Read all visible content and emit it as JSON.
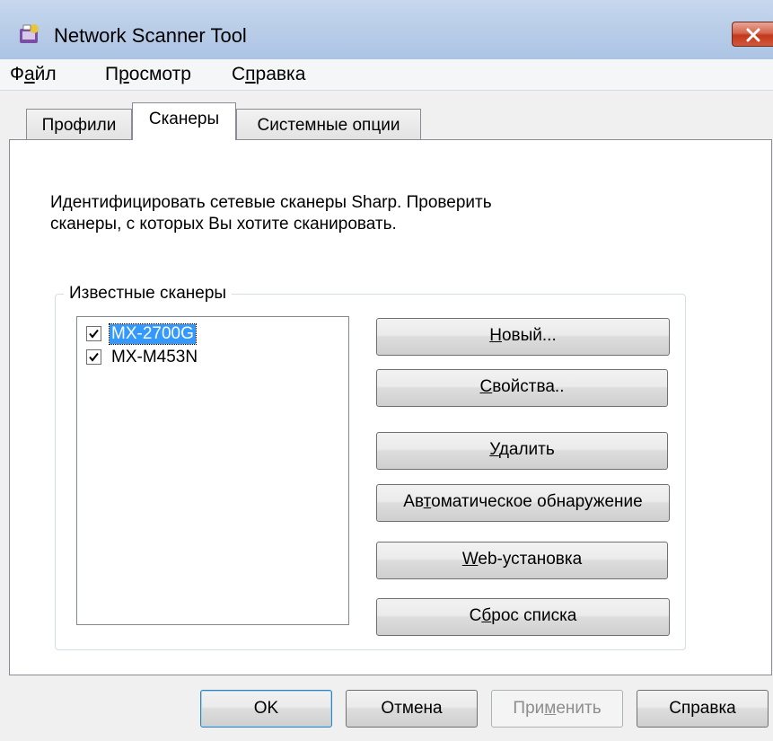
{
  "window": {
    "title": "Network Scanner Tool"
  },
  "menu": {
    "file": {
      "pre": "Ф",
      "key": "а",
      "post": "йл"
    },
    "view": {
      "pre": "П",
      "key": "р",
      "post": "осмотр"
    },
    "help": {
      "pre": "С",
      "key": "п",
      "post": "равка"
    }
  },
  "tabs": {
    "profiles": "Профили",
    "scanners": "Сканеры",
    "system": "Системные опции"
  },
  "description": {
    "line1": "Идентифицировать сетевые сканеры Sharp. Проверить",
    "line2": "сканеры, с которых Вы хотите сканировать."
  },
  "known_scanners": {
    "legend": "Известные сканеры",
    "items": [
      {
        "label": "MX-2700G",
        "checked": true,
        "selected": true
      },
      {
        "label": "MX-M453N",
        "checked": true,
        "selected": false
      }
    ]
  },
  "buttons": {
    "new": {
      "pre": "",
      "key": "Н",
      "post": "овый..."
    },
    "properties": {
      "pre": "",
      "key": "С",
      "post": "войства.."
    },
    "delete": {
      "pre": "",
      "key": "У",
      "post": "далить"
    },
    "autodetect": {
      "pre": "Ав",
      "key": "т",
      "post": "оматическое обнаружение"
    },
    "web_setup": {
      "pre": "",
      "key": "W",
      "post": "eb-установка"
    },
    "reset_list": {
      "pre": "С",
      "key": "б",
      "post": "рос списка"
    }
  },
  "dialog_buttons": {
    "ok": "OK",
    "cancel": "Отмена",
    "apply": {
      "pre": "При",
      "key": "м",
      "post": "енить"
    },
    "help": "Справка"
  },
  "colors": {
    "selection": "#3399ff",
    "close_button": "#c2391c",
    "titlebar": "#b9cde8"
  }
}
